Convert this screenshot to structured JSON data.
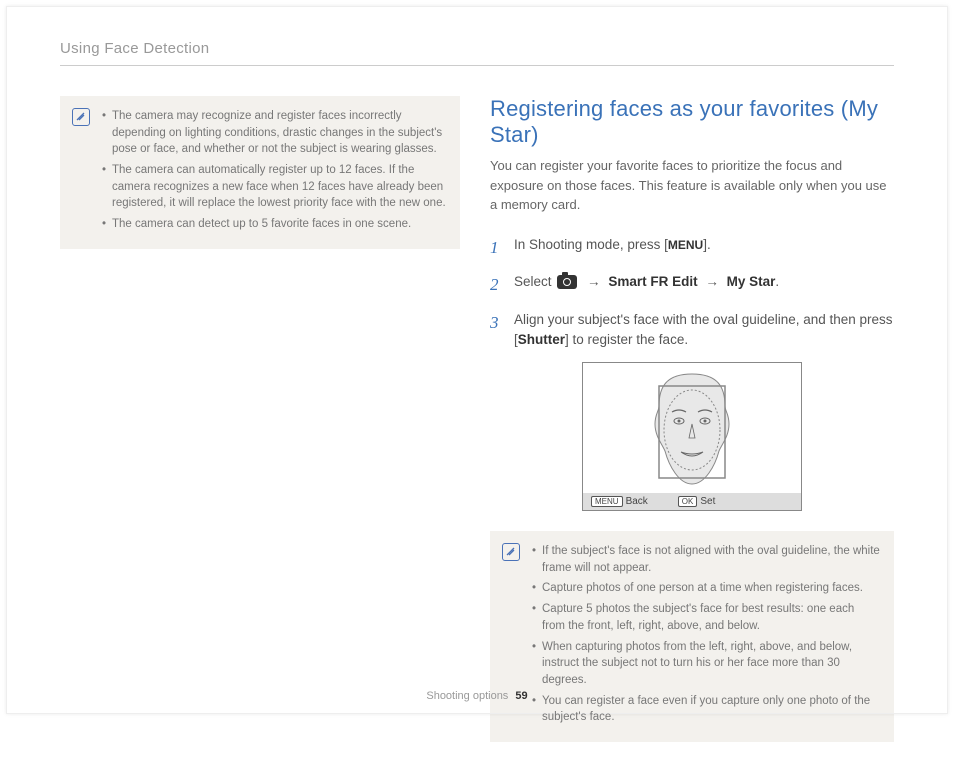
{
  "header": {
    "breadcrumb": "Using Face Detection"
  },
  "left_notes": [
    "The camera may recognize and register faces incorrectly depending on lighting conditions, drastic changes in the subject's pose or face, and whether or not the subject is wearing glasses.",
    "The camera can automatically register up to 12 faces. If the camera recognizes a new face when 12 faces have already been registered, it will replace the lowest priority face with the new one.",
    "The camera can detect up to 5 favorite faces in one scene."
  ],
  "section": {
    "title": "Registering faces as your favorites (My Star)",
    "intro": "You can register your favorite faces to prioritize the focus and exposure on those faces. This feature is available only when you use a memory card."
  },
  "steps": {
    "s1_a": "In Shooting mode, press [",
    "s1_menu": "MENU",
    "s1_b": "].",
    "s2_a": "Select ",
    "s2_arrow": "→",
    "s2_opt1": "Smart FR Edit",
    "s2_opt2": "My Star",
    "s2_b": ".",
    "s3_a": "Align your subject's face with the oval guideline, and then press [",
    "s3_shutter": "Shutter",
    "s3_b": "] to register the face."
  },
  "screen_bar": {
    "back_tag": "MENU",
    "back": "Back",
    "set_tag": "OK",
    "set": "Set"
  },
  "right_notes": [
    "If the subject's face is not aligned with the oval guideline, the white frame will not appear.",
    "Capture photos of one person at a time when registering faces.",
    "Capture 5 photos the subject's face for best results: one each from the front, left, right, above, and below.",
    "When capturing photos from the left, right, above, and below, instruct the subject not to turn his or her face more than 30 degrees.",
    "You can register a face even if you capture only one photo of the subject's face."
  ],
  "footer": {
    "section": "Shooting options",
    "page": "59"
  }
}
